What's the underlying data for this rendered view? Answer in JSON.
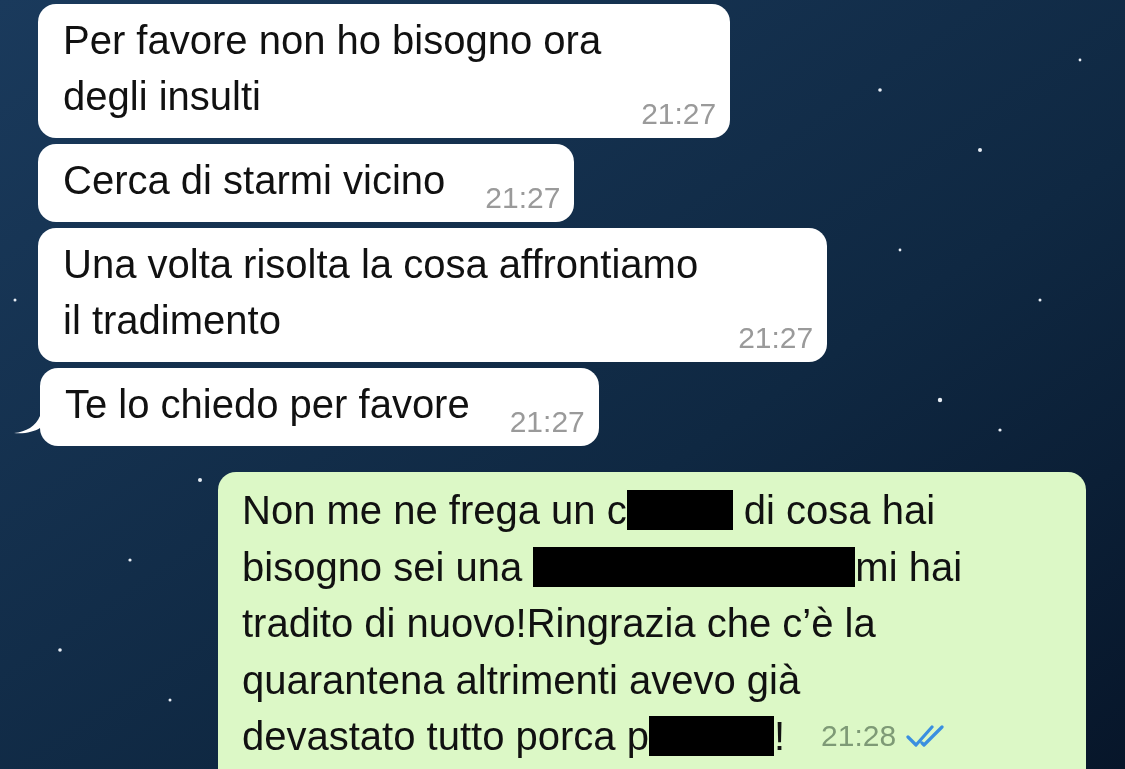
{
  "messages": [
    {
      "kind": "incoming",
      "tail": false,
      "lines": [
        "Per favore non ho bisogno ora",
        "degli insulti"
      ],
      "time": "21:27"
    },
    {
      "kind": "incoming",
      "tail": false,
      "lines": [
        "Cerca di starmi vicino"
      ],
      "time": "21:27"
    },
    {
      "kind": "incoming",
      "tail": false,
      "lines": [
        "Una volta risolta la cosa affrontiamo",
        "il tradimento"
      ],
      "time": "21:27"
    },
    {
      "kind": "incoming",
      "tail": true,
      "lines": [
        "Te lo chiedo per favore"
      ],
      "time": "21:27"
    },
    {
      "kind": "outgoing",
      "read": true,
      "time": "21:28",
      "rows": [
        [
          {
            "kind": "text",
            "text": "Non me ne frega un c"
          },
          {
            "kind": "redaction"
          },
          {
            "kind": "text",
            "text": " di cosa hai"
          }
        ],
        [
          {
            "kind": "text",
            "text": "bisogno sei una "
          },
          {
            "kind": "redaction"
          },
          {
            "kind": "text",
            "text": "mi hai"
          }
        ],
        [
          {
            "kind": "text",
            "text": "tradito di nuovo!Ringrazia che c’è la"
          }
        ],
        [
          {
            "kind": "text",
            "text": "quarantena altrimenti avevo già"
          }
        ],
        [
          {
            "kind": "text",
            "text": "devastato tutto porca p"
          },
          {
            "kind": "redaction"
          },
          {
            "kind": "text",
            "text": "!"
          }
        ]
      ]
    }
  ]
}
